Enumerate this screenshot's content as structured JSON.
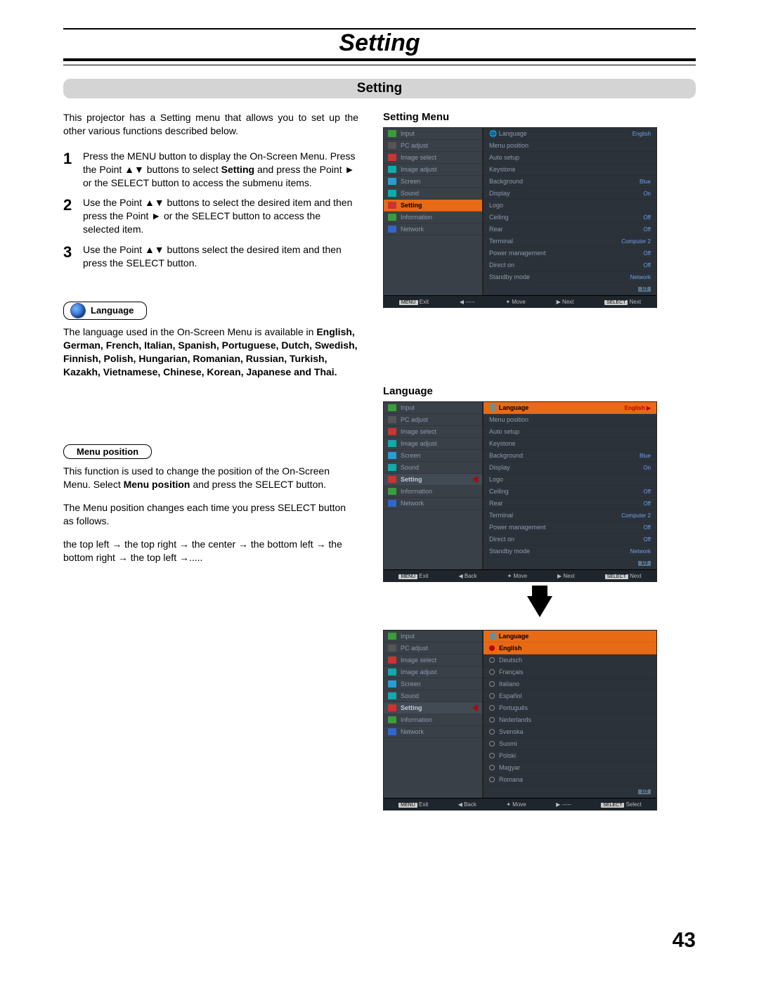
{
  "page": {
    "title": "Setting",
    "section_title": "Setting",
    "number": "43"
  },
  "intro": "This projector has a Setting menu that allows you to set up the other various functions described below.",
  "steps": [
    {
      "num": "1",
      "text": "Press the MENU button to display the On-Screen Menu. Press the Point ▲▼ buttons to select Setting and press the Point ► or the SELECT button to access the submenu items."
    },
    {
      "num": "2",
      "text": "Use the Point ▲▼ buttons to select the desired item and then press the Point ► or the SELECT button to access the selected item."
    },
    {
      "num": "3",
      "text": "Use the Point ▲▼ buttons select the desired item and then press the SELECT button."
    }
  ],
  "lang": {
    "heading": "Language",
    "intro": "The language used in the On-Screen Menu is available in ",
    "list": "English, German, French, Italian, Spanish, Portuguese, Dutch, Swedish, Finnish, Polish, Hungarian, Romanian, Russian, Turkish, Kazakh, Vietnamese, Chinese, Korean, Japanese and Thai."
  },
  "menupos": {
    "heading": "Menu position",
    "p1": "This function is used to change the position of the On-Screen Menu. Select Menu position and press the SELECT button.",
    "p2": "The Menu position changes each time you press SELECT button as follows.",
    "cycle": "the top left  → the top right  → the center → the bottom left → the bottom right → the top left →....."
  },
  "right": {
    "settingmenu_title": "Setting Menu",
    "language_title": "Language",
    "side_items": [
      "Input",
      "PC adjust",
      "Image select",
      "Image adjust",
      "Screen",
      "Sound",
      "Setting",
      "Information",
      "Network"
    ],
    "main_items1": [
      {
        "l": "Language",
        "v": "English"
      },
      {
        "l": "Menu position",
        "v": ""
      },
      {
        "l": "Auto setup",
        "v": ""
      },
      {
        "l": "Keystone",
        "v": ""
      },
      {
        "l": "Background",
        "v": "Blue"
      },
      {
        "l": "Display",
        "v": "On"
      },
      {
        "l": "Logo",
        "v": ""
      },
      {
        "l": "Ceiling",
        "v": "Off"
      },
      {
        "l": "Rear",
        "v": "Off"
      },
      {
        "l": "Terminal",
        "v": "Computer 2"
      },
      {
        "l": "Power management",
        "v": "Off"
      },
      {
        "l": "Direct on",
        "v": "Off"
      },
      {
        "l": "Standby mode",
        "v": "Network"
      }
    ],
    "page_indicator": "1/2",
    "lang_options": [
      "English",
      "Deutsch",
      "Français",
      "Italiano",
      "Español",
      "Português",
      "Nederlands",
      "Svenska",
      "Suomi",
      "Polski",
      "Magyar",
      "Romana"
    ],
    "bar1": {
      "exit": "Exit",
      "back": "-----",
      "move": "Move",
      "next": "Next",
      "select": "Next"
    },
    "bar2": {
      "exit": "Exit",
      "back": "Back",
      "move": "Move",
      "next": "Next",
      "select": "Next"
    },
    "bar3": {
      "exit": "Exit",
      "back": "Back",
      "move": "Move",
      "next": "-----",
      "select": "Select"
    }
  }
}
